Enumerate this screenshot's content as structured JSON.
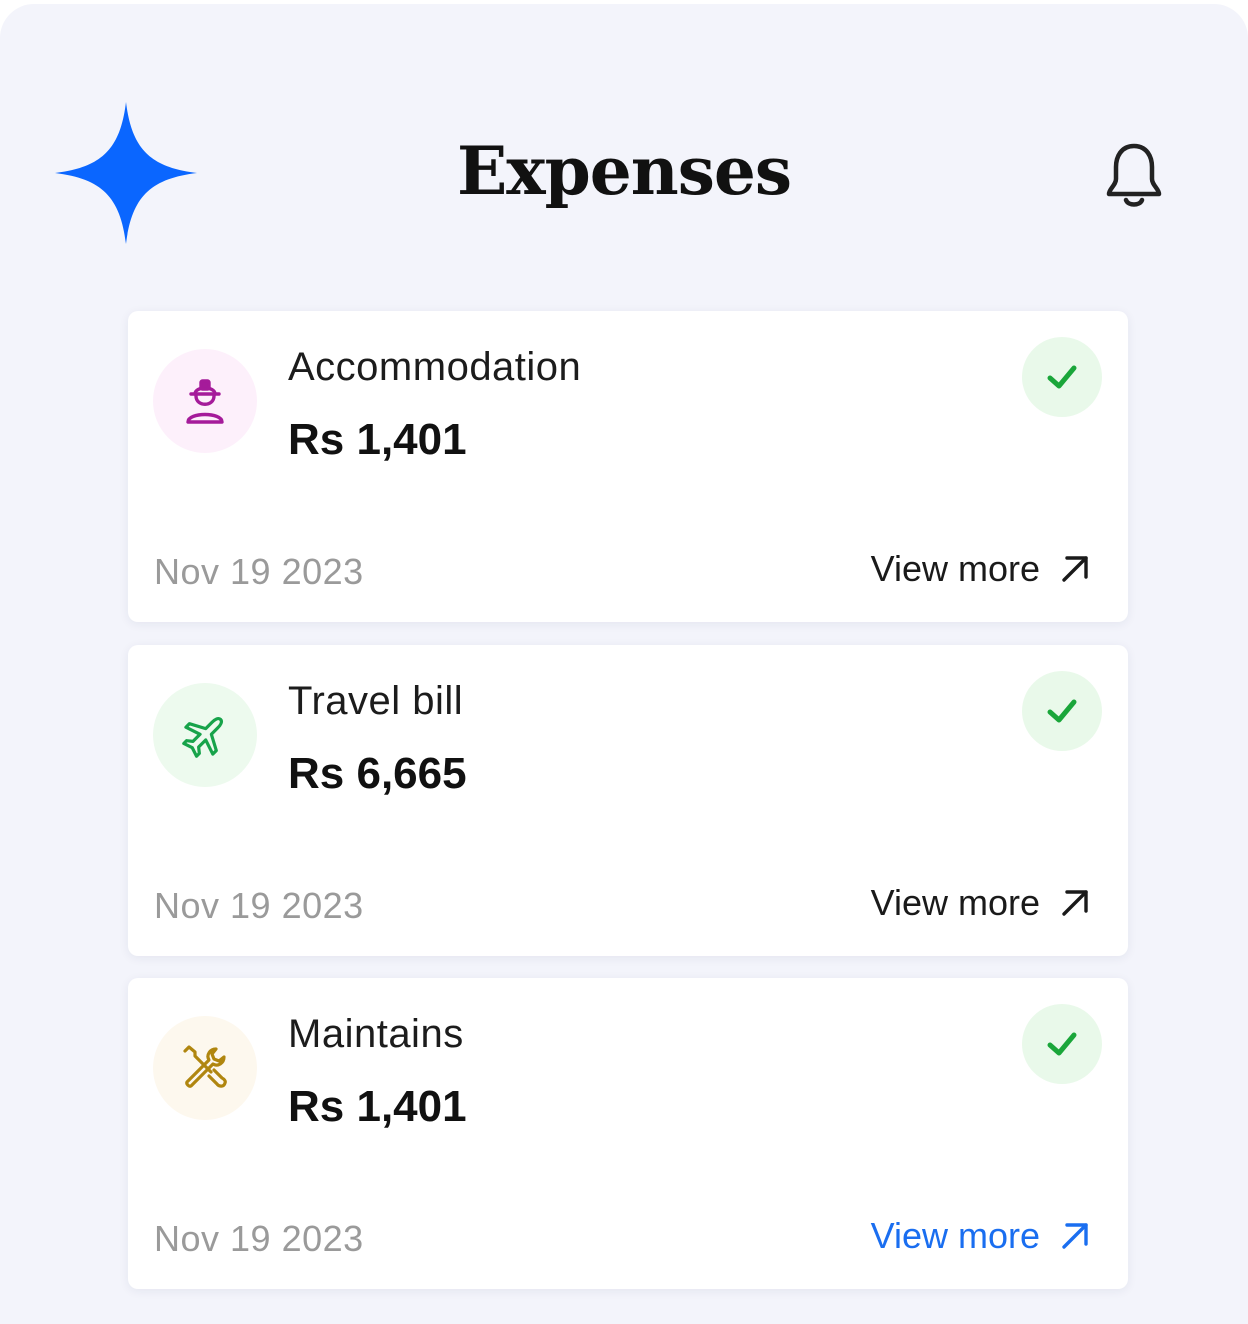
{
  "header": {
    "title": "Expenses",
    "logo_icon": "sparkle-icon",
    "notification_icon": "bell-icon"
  },
  "colors": {
    "background": "#f3f4fb",
    "accent": "#0a66ff",
    "link_active": "#1a6ef0",
    "approved_green": "#1aa63a"
  },
  "expenses": [
    {
      "category": "Accommodation",
      "amount": "Rs 1,401",
      "date": "Nov 19 2023",
      "link_label": "View more",
      "icon": "worker-icon",
      "status_icon": "check-icon"
    },
    {
      "category": "Travel bill",
      "amount": "Rs 6,665",
      "date": "Nov 19 2023",
      "link_label": "View more",
      "icon": "airplane-icon",
      "status_icon": "check-icon"
    },
    {
      "category": "Maintains",
      "amount": "Rs 1,401",
      "date": "Nov 19 2023",
      "link_label": "View more",
      "icon": "tools-icon",
      "status_icon": "check-icon"
    }
  ]
}
